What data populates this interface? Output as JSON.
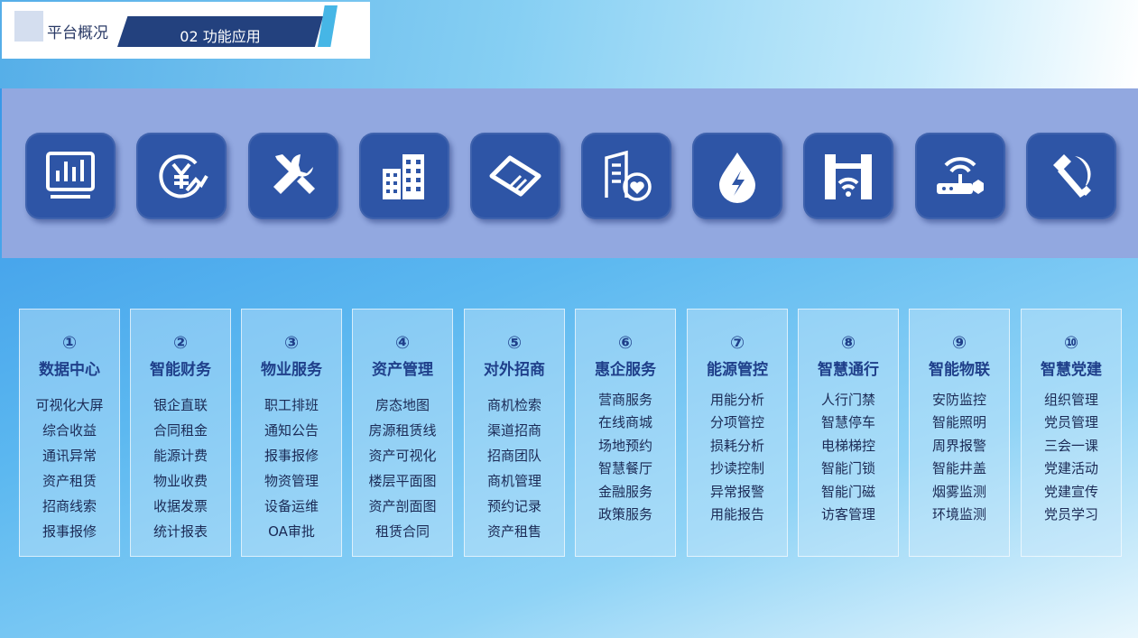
{
  "header": {
    "section_label": "平台概况",
    "current_tab": "02 功能应用"
  },
  "colors": {
    "tile": "#2e55a6",
    "band": "#92a8e0",
    "title_text": "#1f3f8a"
  },
  "icons": [
    "dashboard-chart-icon",
    "yuan-finance-icon",
    "tools-wrench-icon",
    "buildings-icon",
    "handshake-icon",
    "office-heart-icon",
    "water-drop-energy-icon",
    "gate-wifi-icon",
    "router-iot-icon",
    "hammer-sickle-icon"
  ],
  "cards": [
    {
      "num": "①",
      "title": "数据中心",
      "items": [
        "可视化大屏",
        "综合收益",
        "通讯异常",
        "资产租赁",
        "招商线索",
        "报事报修"
      ]
    },
    {
      "num": "②",
      "title": "智能财务",
      "items": [
        "银企直联",
        "合同租金",
        "能源计费",
        "物业收费",
        "收据发票",
        "统计报表"
      ]
    },
    {
      "num": "③",
      "title": "物业服务",
      "items": [
        "职工排班",
        "通知公告",
        "报事报修",
        "物资管理",
        "设备运维",
        "OA审批"
      ]
    },
    {
      "num": "④",
      "title": "资产管理",
      "items": [
        "房态地图",
        "房源租赁线",
        "资产可视化",
        "楼层平面图",
        "资产剖面图",
        "租赁合同"
      ]
    },
    {
      "num": "⑤",
      "title": "对外招商",
      "items": [
        "商机检索",
        "渠道招商",
        "招商团队",
        "商机管理",
        "预约记录",
        "资产租售"
      ]
    },
    {
      "num": "⑥",
      "title": "惠企服务",
      "items": [
        "营商服务",
        "在线商城",
        "场地预约",
        "智慧餐厅",
        "金融服务",
        "政策服务"
      ]
    },
    {
      "num": "⑦",
      "title": "能源管控",
      "items": [
        "用能分析",
        "分项管控",
        "损耗分析",
        "抄读控制",
        "异常报警",
        "用能报告"
      ]
    },
    {
      "num": "⑧",
      "title": "智慧通行",
      "items": [
        "人行门禁",
        "智慧停车",
        "电梯梯控",
        "智能门锁",
        "智能门磁",
        "访客管理"
      ]
    },
    {
      "num": "⑨",
      "title": "智能物联",
      "items": [
        "安防监控",
        "智能照明",
        "周界报警",
        "智能井盖",
        "烟雾监测",
        "环境监测"
      ]
    },
    {
      "num": "⑩",
      "title": "智慧党建",
      "items": [
        "组织管理",
        "党员管理",
        "三会一课",
        "党建活动",
        "党建宣传",
        "党员学习"
      ]
    }
  ]
}
